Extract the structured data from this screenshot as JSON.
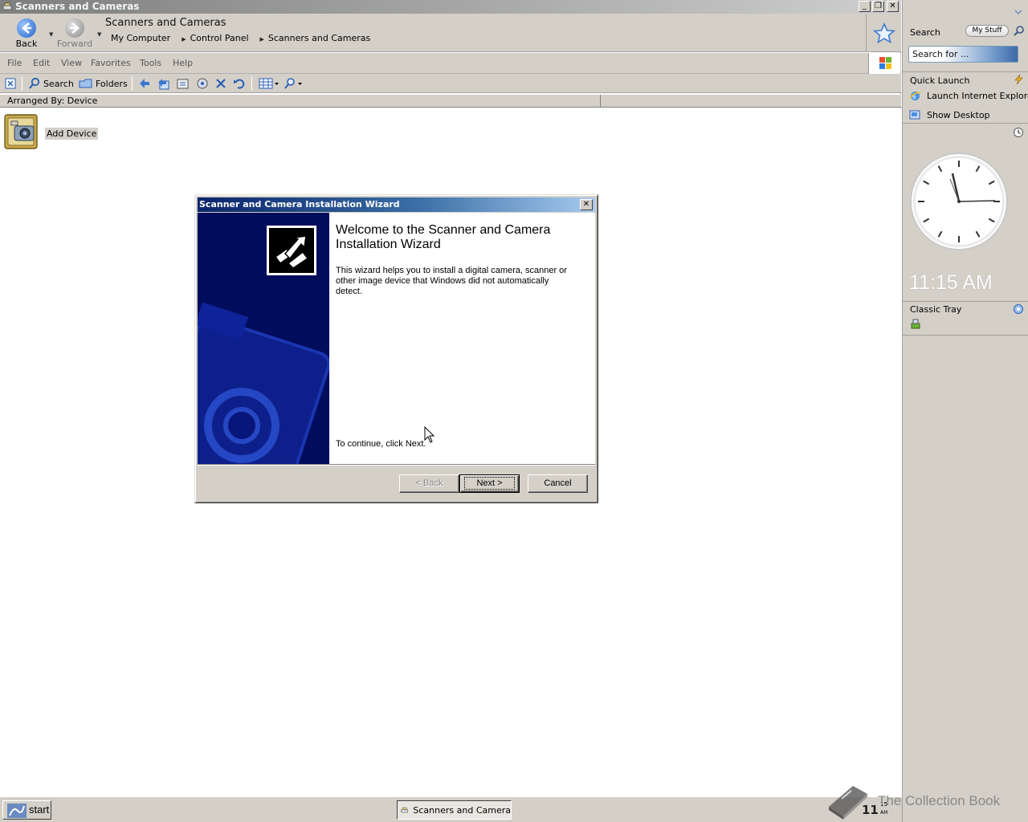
{
  "window": {
    "title": "Scanners and Cameras",
    "nav": {
      "back": "Back",
      "forward": "Forward"
    },
    "location_title": "Scanners and Cameras",
    "breadcrumbs": [
      "My Computer",
      "Control Panel",
      "Scanners and Cameras"
    ],
    "menu": [
      "File",
      "Edit",
      "View",
      "Favorites",
      "Tools",
      "Help"
    ],
    "toolbar": {
      "search": "Search",
      "folders": "Folders"
    },
    "column_header": "Arranged By: Device",
    "items": [
      {
        "label": "Add Device",
        "icon": "camera-scanner-icon"
      }
    ]
  },
  "wizard": {
    "title": "Scanner and Camera Installation Wizard",
    "heading": "Welcome to the Scanner and Camera Installation Wizard",
    "description": "This wizard helps you to install a digital camera, scanner or other image device that Windows did not automatically detect.",
    "continue_text": "To continue, click Next.",
    "buttons": {
      "back": "< Back",
      "next": "Next >",
      "cancel": "Cancel"
    }
  },
  "sidebar": {
    "search": {
      "title": "Search",
      "my_stuff": "My Stuff",
      "placeholder": "Search for ..."
    },
    "quick_launch": {
      "title": "Quick Launch",
      "items": [
        "Launch Internet Explorer",
        "Show Desktop"
      ]
    },
    "clock": {
      "time": "11:15 AM"
    },
    "classic_tray": {
      "title": "Classic Tray"
    }
  },
  "taskbar": {
    "start": "start",
    "task": "Scanners and Camera",
    "clock_hour": "11",
    "clock_minute": "15",
    "clock_ampm": "AM"
  },
  "watermark": "The Collection Book",
  "colors": {
    "wizard_title_start": "#0a246a",
    "wizard_title_end": "#a6caf0",
    "wizard_banner": "#000c5c",
    "chrome": "#d4d0c8"
  }
}
